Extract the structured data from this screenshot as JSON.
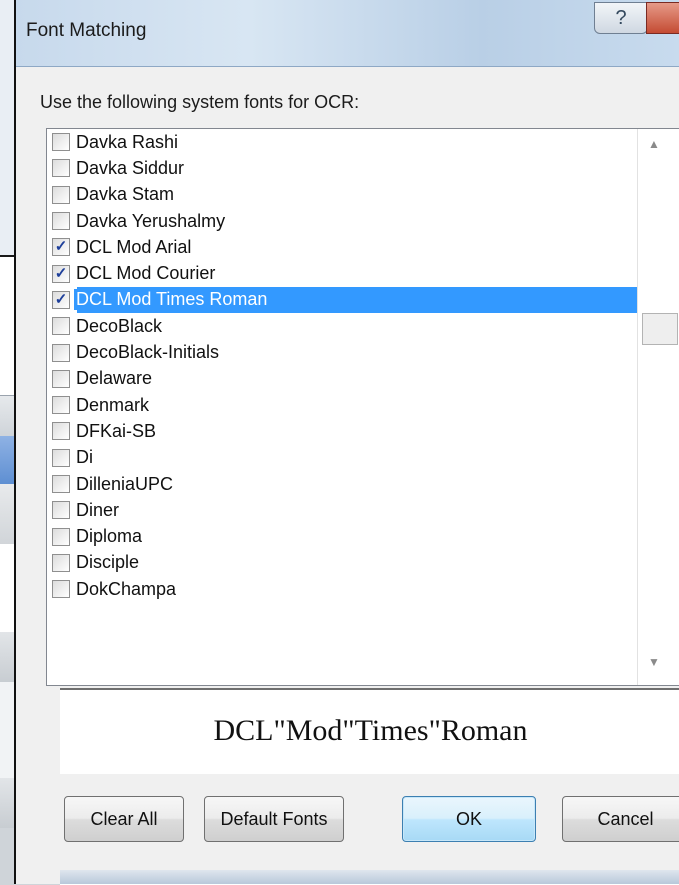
{
  "dialog": {
    "title": "Font Matching",
    "help_glyph": "?",
    "instruction": "Use the following system fonts for OCR:",
    "fonts": [
      {
        "name": "Davka Rashi",
        "checked": false,
        "selected": false
      },
      {
        "name": "Davka Siddur",
        "checked": false,
        "selected": false
      },
      {
        "name": "Davka Stam",
        "checked": false,
        "selected": false
      },
      {
        "name": "Davka Yerushalmy",
        "checked": false,
        "selected": false
      },
      {
        "name": "DCL Mod Arial",
        "checked": true,
        "selected": false
      },
      {
        "name": "DCL Mod Courier",
        "checked": true,
        "selected": false
      },
      {
        "name": "DCL Mod Times Roman",
        "checked": true,
        "selected": true
      },
      {
        "name": "DecoBlack",
        "checked": false,
        "selected": false
      },
      {
        "name": "DecoBlack-Initials",
        "checked": false,
        "selected": false
      },
      {
        "name": "Delaware",
        "checked": false,
        "selected": false
      },
      {
        "name": "Denmark",
        "checked": false,
        "selected": false
      },
      {
        "name": "DFKai-SB",
        "checked": false,
        "selected": false
      },
      {
        "name": "Di",
        "checked": false,
        "selected": false
      },
      {
        "name": "DilleniaUPC",
        "checked": false,
        "selected": false
      },
      {
        "name": "Diner",
        "checked": false,
        "selected": false
      },
      {
        "name": "Diploma",
        "checked": false,
        "selected": false
      },
      {
        "name": "Disciple",
        "checked": false,
        "selected": false
      },
      {
        "name": "DokChampa",
        "checked": false,
        "selected": false
      }
    ],
    "preview_text": "DCL\"Mod\"Times\"Roman",
    "buttons": {
      "clear_all": "Clear All",
      "default_fonts": "Default Fonts",
      "ok": "OK",
      "cancel": "Cancel"
    }
  },
  "icons": {
    "scroll_up": "scroll-up-arrow-icon",
    "scroll_down": "scroll-down-arrow-icon",
    "check": "checkmark-icon"
  }
}
